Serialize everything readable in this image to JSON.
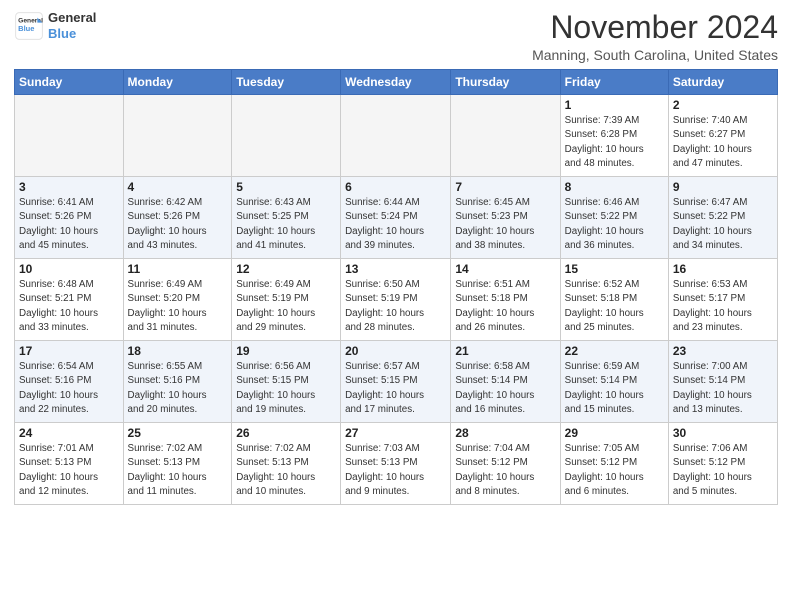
{
  "header": {
    "logo_line1": "General",
    "logo_line2": "Blue",
    "month": "November 2024",
    "location": "Manning, South Carolina, United States"
  },
  "weekdays": [
    "Sunday",
    "Monday",
    "Tuesday",
    "Wednesday",
    "Thursday",
    "Friday",
    "Saturday"
  ],
  "weeks": [
    [
      {
        "day": "",
        "info": ""
      },
      {
        "day": "",
        "info": ""
      },
      {
        "day": "",
        "info": ""
      },
      {
        "day": "",
        "info": ""
      },
      {
        "day": "",
        "info": ""
      },
      {
        "day": "1",
        "info": "Sunrise: 7:39 AM\nSunset: 6:28 PM\nDaylight: 10 hours\nand 48 minutes."
      },
      {
        "day": "2",
        "info": "Sunrise: 7:40 AM\nSunset: 6:27 PM\nDaylight: 10 hours\nand 47 minutes."
      }
    ],
    [
      {
        "day": "3",
        "info": "Sunrise: 6:41 AM\nSunset: 5:26 PM\nDaylight: 10 hours\nand 45 minutes."
      },
      {
        "day": "4",
        "info": "Sunrise: 6:42 AM\nSunset: 5:26 PM\nDaylight: 10 hours\nand 43 minutes."
      },
      {
        "day": "5",
        "info": "Sunrise: 6:43 AM\nSunset: 5:25 PM\nDaylight: 10 hours\nand 41 minutes."
      },
      {
        "day": "6",
        "info": "Sunrise: 6:44 AM\nSunset: 5:24 PM\nDaylight: 10 hours\nand 39 minutes."
      },
      {
        "day": "7",
        "info": "Sunrise: 6:45 AM\nSunset: 5:23 PM\nDaylight: 10 hours\nand 38 minutes."
      },
      {
        "day": "8",
        "info": "Sunrise: 6:46 AM\nSunset: 5:22 PM\nDaylight: 10 hours\nand 36 minutes."
      },
      {
        "day": "9",
        "info": "Sunrise: 6:47 AM\nSunset: 5:22 PM\nDaylight: 10 hours\nand 34 minutes."
      }
    ],
    [
      {
        "day": "10",
        "info": "Sunrise: 6:48 AM\nSunset: 5:21 PM\nDaylight: 10 hours\nand 33 minutes."
      },
      {
        "day": "11",
        "info": "Sunrise: 6:49 AM\nSunset: 5:20 PM\nDaylight: 10 hours\nand 31 minutes."
      },
      {
        "day": "12",
        "info": "Sunrise: 6:49 AM\nSunset: 5:19 PM\nDaylight: 10 hours\nand 29 minutes."
      },
      {
        "day": "13",
        "info": "Sunrise: 6:50 AM\nSunset: 5:19 PM\nDaylight: 10 hours\nand 28 minutes."
      },
      {
        "day": "14",
        "info": "Sunrise: 6:51 AM\nSunset: 5:18 PM\nDaylight: 10 hours\nand 26 minutes."
      },
      {
        "day": "15",
        "info": "Sunrise: 6:52 AM\nSunset: 5:18 PM\nDaylight: 10 hours\nand 25 minutes."
      },
      {
        "day": "16",
        "info": "Sunrise: 6:53 AM\nSunset: 5:17 PM\nDaylight: 10 hours\nand 23 minutes."
      }
    ],
    [
      {
        "day": "17",
        "info": "Sunrise: 6:54 AM\nSunset: 5:16 PM\nDaylight: 10 hours\nand 22 minutes."
      },
      {
        "day": "18",
        "info": "Sunrise: 6:55 AM\nSunset: 5:16 PM\nDaylight: 10 hours\nand 20 minutes."
      },
      {
        "day": "19",
        "info": "Sunrise: 6:56 AM\nSunset: 5:15 PM\nDaylight: 10 hours\nand 19 minutes."
      },
      {
        "day": "20",
        "info": "Sunrise: 6:57 AM\nSunset: 5:15 PM\nDaylight: 10 hours\nand 17 minutes."
      },
      {
        "day": "21",
        "info": "Sunrise: 6:58 AM\nSunset: 5:14 PM\nDaylight: 10 hours\nand 16 minutes."
      },
      {
        "day": "22",
        "info": "Sunrise: 6:59 AM\nSunset: 5:14 PM\nDaylight: 10 hours\nand 15 minutes."
      },
      {
        "day": "23",
        "info": "Sunrise: 7:00 AM\nSunset: 5:14 PM\nDaylight: 10 hours\nand 13 minutes."
      }
    ],
    [
      {
        "day": "24",
        "info": "Sunrise: 7:01 AM\nSunset: 5:13 PM\nDaylight: 10 hours\nand 12 minutes."
      },
      {
        "day": "25",
        "info": "Sunrise: 7:02 AM\nSunset: 5:13 PM\nDaylight: 10 hours\nand 11 minutes."
      },
      {
        "day": "26",
        "info": "Sunrise: 7:02 AM\nSunset: 5:13 PM\nDaylight: 10 hours\nand 10 minutes."
      },
      {
        "day": "27",
        "info": "Sunrise: 7:03 AM\nSunset: 5:13 PM\nDaylight: 10 hours\nand 9 minutes."
      },
      {
        "day": "28",
        "info": "Sunrise: 7:04 AM\nSunset: 5:12 PM\nDaylight: 10 hours\nand 8 minutes."
      },
      {
        "day": "29",
        "info": "Sunrise: 7:05 AM\nSunset: 5:12 PM\nDaylight: 10 hours\nand 6 minutes."
      },
      {
        "day": "30",
        "info": "Sunrise: 7:06 AM\nSunset: 5:12 PM\nDaylight: 10 hours\nand 5 minutes."
      }
    ]
  ]
}
